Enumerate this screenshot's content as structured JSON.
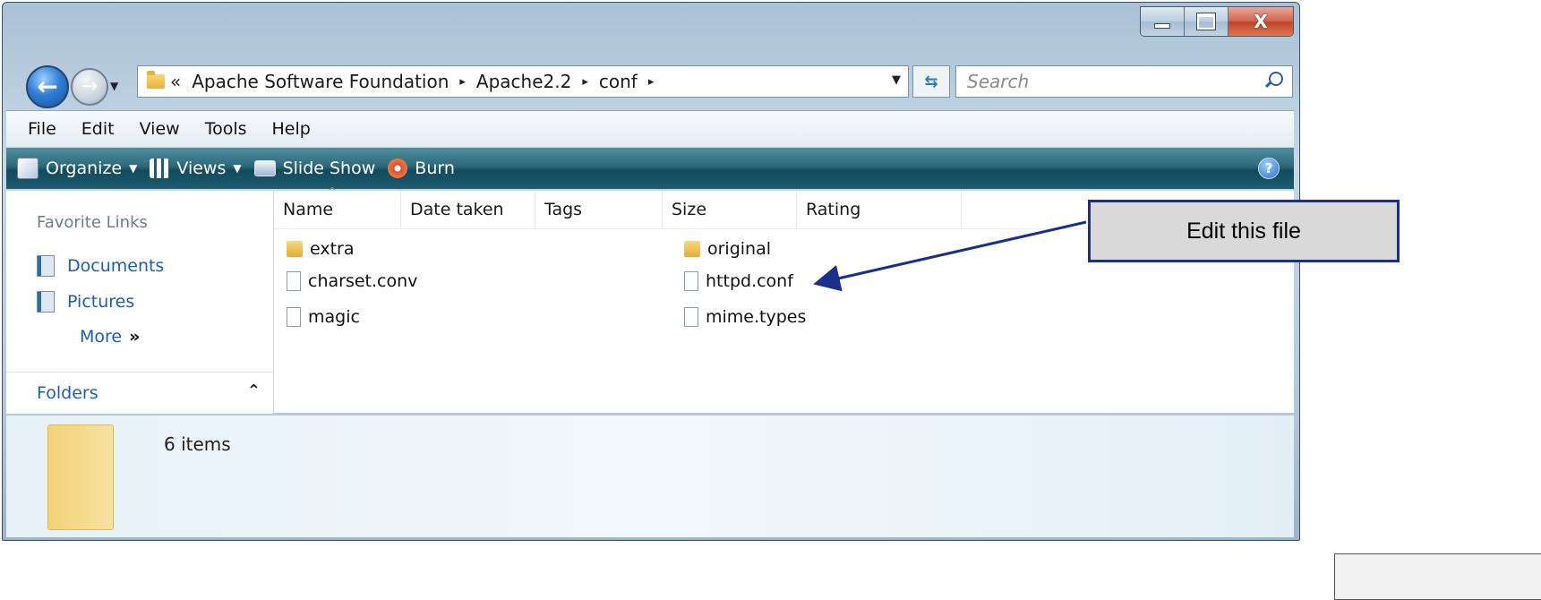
{
  "window": {
    "caption_buttons": {
      "minimize": "minimize-icon",
      "maximize": "maximize-icon",
      "close": "X"
    }
  },
  "address_bar": {
    "overflow": "«",
    "crumbs": [
      "Apache Software Foundation",
      "Apache2.2",
      "conf"
    ],
    "separator": "▸"
  },
  "search": {
    "placeholder": "Search"
  },
  "menu": [
    "File",
    "Edit",
    "View",
    "Tools",
    "Help"
  ],
  "toolbar": {
    "organize": "Organize",
    "views": "Views",
    "slideshow": "Slide Show",
    "burn": "Burn",
    "help": "?"
  },
  "nav": {
    "favorite_links_title": "Favorite Links",
    "links": [
      "Documents",
      "Pictures"
    ],
    "more": "More",
    "more_glyph": "»",
    "folders": "Folders"
  },
  "columns": [
    "Name",
    "Date taken",
    "Tags",
    "Size",
    "Rating"
  ],
  "files": {
    "col1": [
      {
        "name": "extra",
        "type": "folder"
      },
      {
        "name": "charset.conv",
        "type": "file"
      },
      {
        "name": "magic",
        "type": "file"
      }
    ],
    "col2": [
      {
        "name": "original",
        "type": "folder"
      },
      {
        "name": "httpd.conf",
        "type": "file"
      },
      {
        "name": "mime.types",
        "type": "file"
      }
    ]
  },
  "details": {
    "item_count": "6 items"
  },
  "annotation": {
    "callout_text": "Edit this file"
  },
  "colors": {
    "toolbar": "#1d5d70",
    "link": "#1b5fb3",
    "callout_border": "#1a2f8c"
  }
}
